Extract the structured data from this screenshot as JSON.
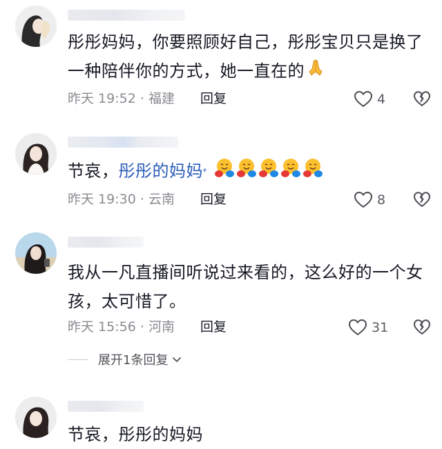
{
  "comments": [
    {
      "text": "彤彤妈妈，你要照顾好自己，彤彤宝贝只是换了一种陪伴你的方式，她一直在的",
      "emoji_icon": "folded-hands-emoji",
      "time": "昨天 19:52",
      "separator": "·",
      "location": "福建",
      "reply_label": "回复",
      "likes": "4",
      "like_icon": "heart-outline-icon",
      "dislike_icon": "broken-heart-icon"
    },
    {
      "text_prefix": "节哀，",
      "mention": "彤彤的妈妈",
      "emoji_icon": "hugging-face-emoji",
      "emoji_count": 5,
      "time": "昨天 19:30",
      "separator": "·",
      "location": "云南",
      "reply_label": "回复",
      "likes": "8",
      "like_icon": "heart-outline-icon",
      "dislike_icon": "broken-heart-icon"
    },
    {
      "text": "我从一凡直播间听说过来看的，这么好的一个女孩，太可惜了。",
      "time": "昨天 15:56",
      "separator": "·",
      "location": "河南",
      "reply_label": "回复",
      "likes": "31",
      "like_icon": "heart-outline-icon",
      "dislike_icon": "broken-heart-icon",
      "expand_label": "展开1条回复",
      "expand_icon": "chevron-down-icon"
    },
    {
      "text": "节哀，彤彤的妈妈"
    }
  ],
  "colors": {
    "text": "#161823",
    "meta": "#8a8b91",
    "mention": "#2b5db8"
  }
}
